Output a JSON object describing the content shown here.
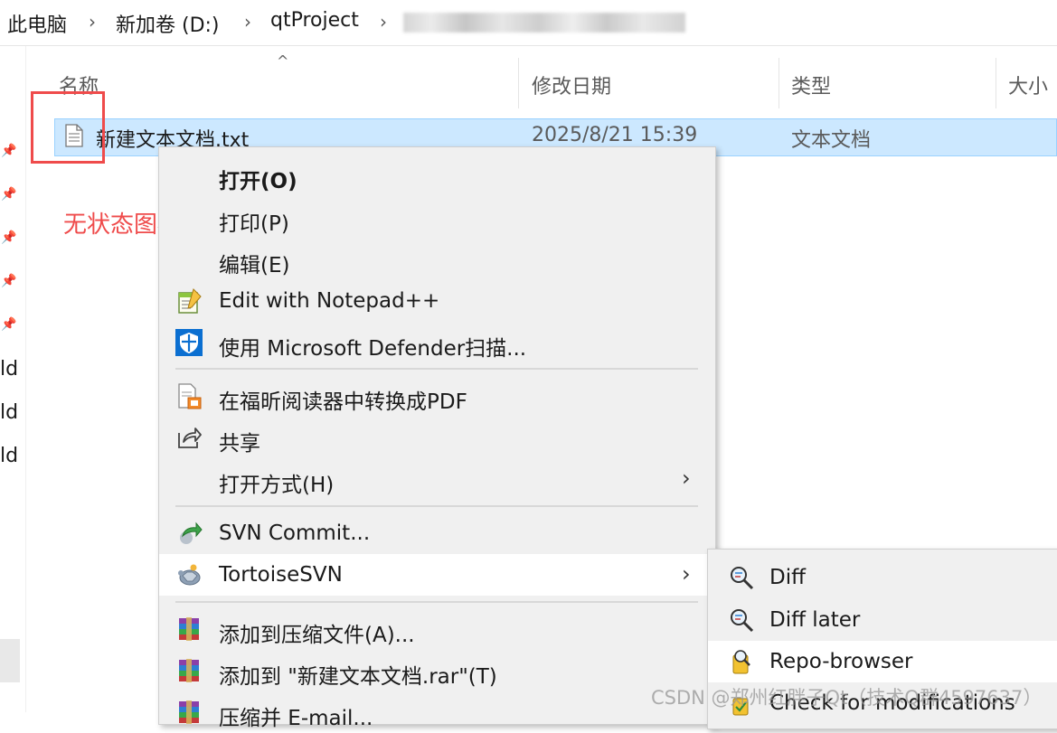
{
  "breadcrumb": {
    "items": [
      "此电脑",
      "新加卷 (D:)",
      "qtProject"
    ],
    "separator": "›"
  },
  "columns": {
    "name": "名称",
    "modified": "修改日期",
    "type": "类型",
    "size": "大小"
  },
  "file_row": {
    "name": "新建文本文档.txt",
    "modified": "2025/8/21 15:39",
    "type": "文本文档",
    "icon": "text-file-icon"
  },
  "nav": {
    "partial_labels": [
      "ld",
      "ld",
      "ld"
    ]
  },
  "annotation": {
    "text": "无状态图标",
    "color": "#ef4b4b"
  },
  "context_menu": {
    "items": [
      {
        "label": "打开(O)",
        "bold": true,
        "icon": ""
      },
      {
        "label": "打印(P)",
        "icon": ""
      },
      {
        "label": "编辑(E)",
        "icon": ""
      },
      {
        "label": "Edit with Notepad++",
        "icon": "notepadpp-icon"
      },
      {
        "label": "使用 Microsoft Defender扫描...",
        "icon": "defender-shield-icon"
      },
      {
        "label": "在福昕阅读器中转换成PDF",
        "icon": "pdf-convert-icon"
      },
      {
        "label": "共享",
        "icon": "share-icon"
      },
      {
        "label": "打开方式(H)",
        "icon": "",
        "submenu": true
      },
      {
        "label": "SVN Commit...",
        "icon": "svn-commit-icon"
      },
      {
        "label": "TortoiseSVN",
        "icon": "tortoisesvn-icon",
        "submenu": true
      },
      {
        "label": "添加到压缩文件(A)...",
        "icon": "winrar-icon"
      },
      {
        "label": "添加到 \"新建文本文档.rar\"(T)",
        "icon": "winrar-icon"
      },
      {
        "label": "压缩并 E-mail...",
        "icon": "winrar-icon"
      }
    ]
  },
  "svn_submenu": {
    "items": [
      {
        "label": "Diff",
        "icon": "diff-magnifier-icon"
      },
      {
        "label": "Diff later",
        "icon": "diff-magnifier-icon"
      },
      {
        "label": "Repo-browser",
        "icon": "repo-browser-icon"
      },
      {
        "label": "Check for modifications",
        "icon": "check-modifications-icon"
      }
    ]
  },
  "watermark": "CSDN @郑州红胖子Qt（技术Q群4597637）",
  "colors": {
    "selection_bg": "#cce8ff",
    "selection_border": "#99d1ff",
    "menu_bg": "#f0f0f0",
    "menu_hover": "#ffffff"
  }
}
